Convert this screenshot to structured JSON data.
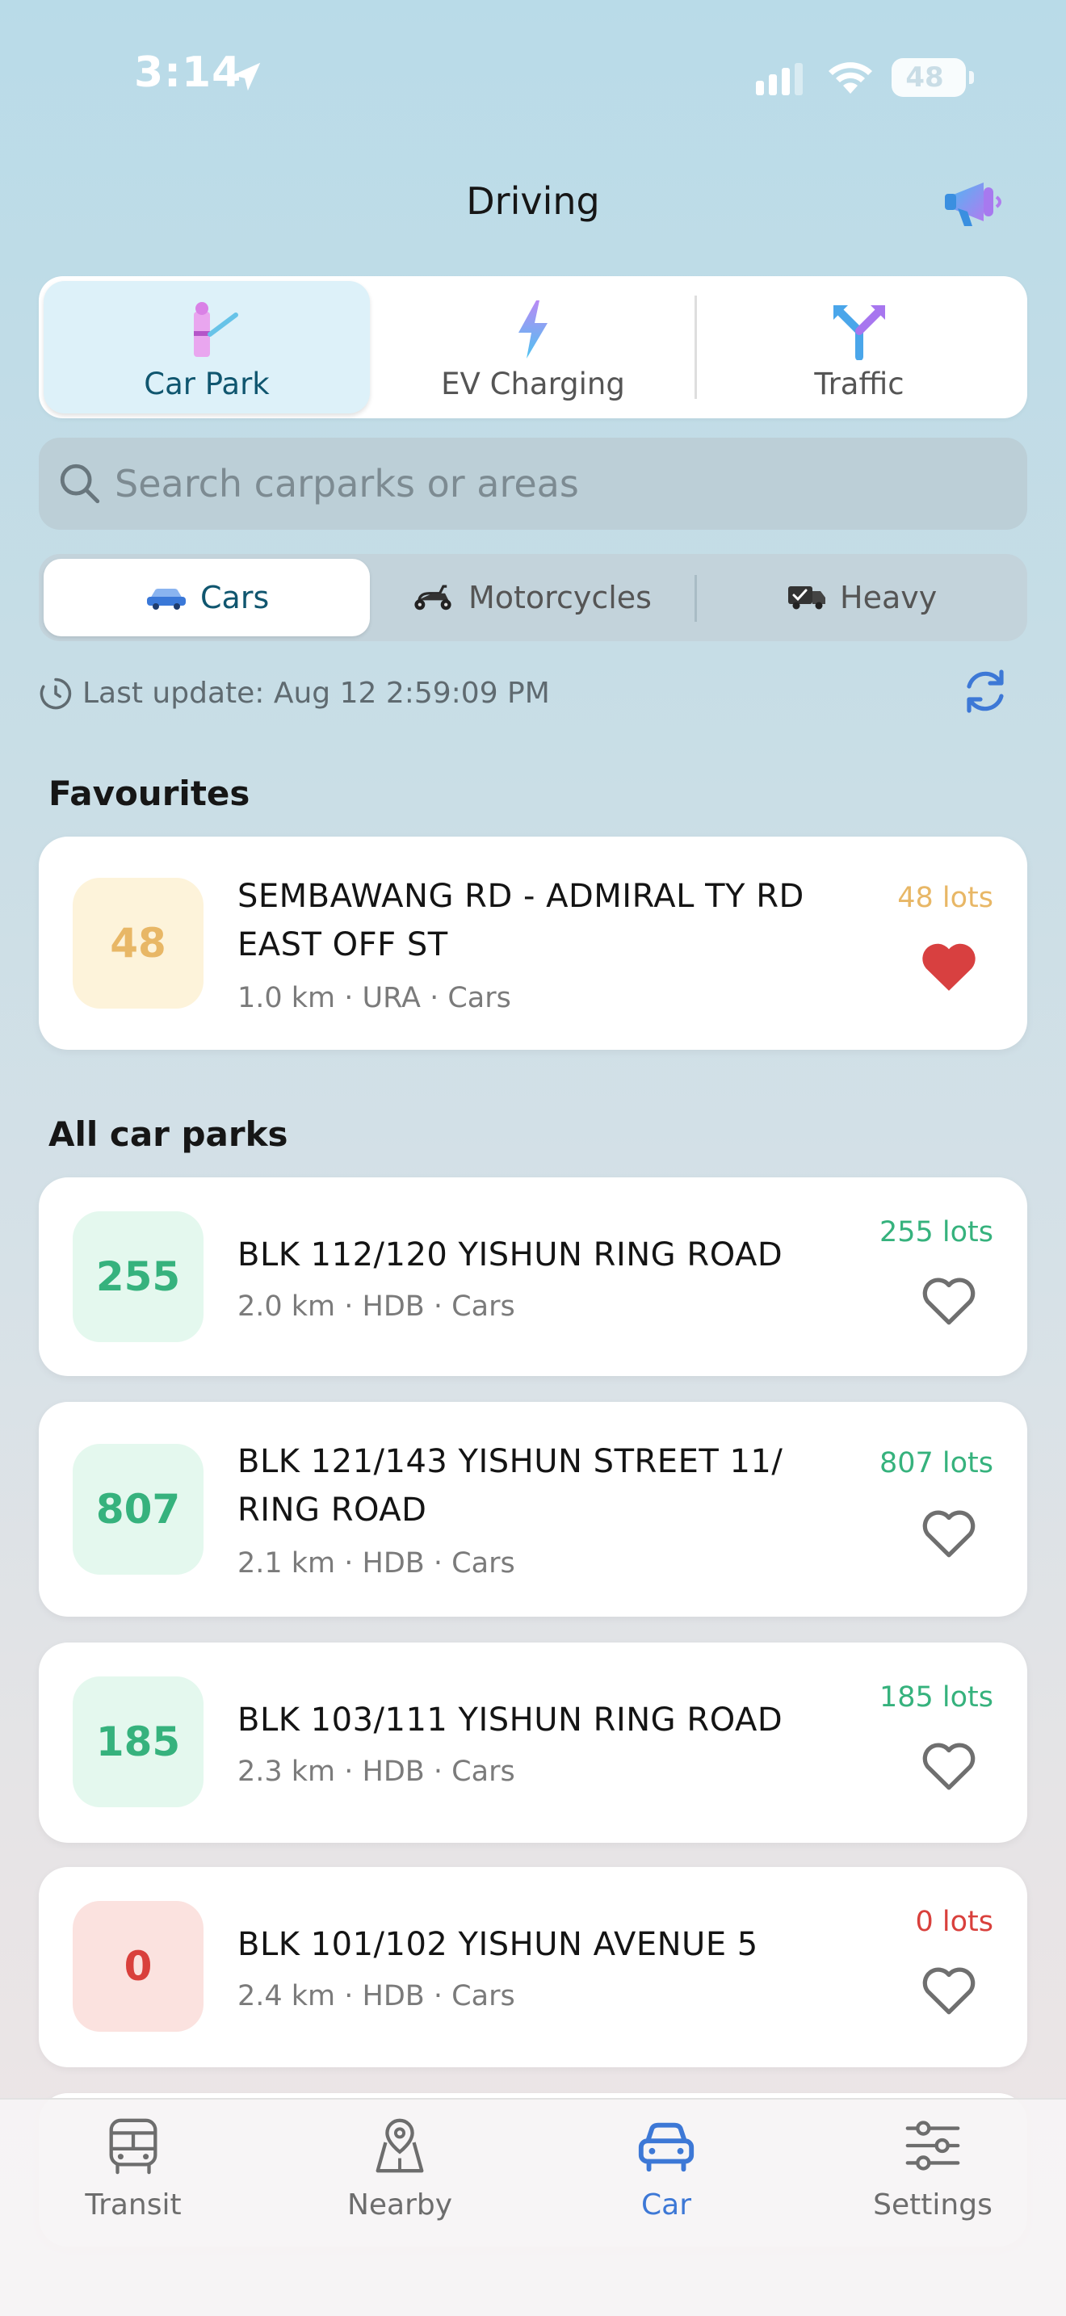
{
  "status_bar": {
    "time": "3:14",
    "battery": "48"
  },
  "header": {
    "title": "Driving"
  },
  "mode_tabs": [
    {
      "label": "Car Park",
      "active": true
    },
    {
      "label": "EV Charging",
      "active": false
    },
    {
      "label": "Traffic",
      "active": false
    }
  ],
  "search": {
    "placeholder": "Search carparks or areas",
    "value": ""
  },
  "vehicle_tabs": [
    {
      "label": "Cars",
      "active": true
    },
    {
      "label": "Motorcycles",
      "active": false
    },
    {
      "label": "Heavy",
      "active": false
    }
  ],
  "last_update": "Last update: Aug 12 2:59:09 PM",
  "favourites": {
    "title": "Favourites",
    "items": [
      {
        "count": "48",
        "name": "SEMBAWANG RD - ADMIRAL TY RD EAST OFF ST",
        "meta": "1.0 km · URA · Cars",
        "lots": "48 lots",
        "status": "yellow",
        "favourite": true
      }
    ]
  },
  "all_car_parks": {
    "title": "All car parks",
    "items": [
      {
        "count": "255",
        "name": "BLK 112/120 YISHUN RING ROAD",
        "meta": "2.0 km · HDB · Cars",
        "lots": "255 lots",
        "status": "green",
        "favourite": false
      },
      {
        "count": "807",
        "name": "BLK 121/143 YISHUN STREET 11/ RING ROAD",
        "meta": "2.1 km · HDB · Cars",
        "lots": "807 lots",
        "status": "green",
        "favourite": false
      },
      {
        "count": "185",
        "name": "BLK 103/111 YISHUN RING ROAD",
        "meta": "2.3 km · HDB · Cars",
        "lots": "185 lots",
        "status": "green",
        "favourite": false
      },
      {
        "count": "0",
        "name": "BLK 101/102 YISHUN AVENUE 5",
        "meta": "2.4 km · HDB · Cars",
        "lots": "0 lots",
        "status": "red",
        "favourite": false
      }
    ]
  },
  "bottom_tabs": [
    {
      "label": "Transit",
      "icon": "bus-icon",
      "active": false
    },
    {
      "label": "Nearby",
      "icon": "map-pin-icon",
      "active": false
    },
    {
      "label": "Car",
      "icon": "car-icon",
      "active": true
    },
    {
      "label": "Settings",
      "icon": "sliders-icon",
      "active": false
    }
  ],
  "colors": {
    "accent": "#3d78d6",
    "green": "#36b27d",
    "yellow": "#e8b766",
    "red": "#d9403c",
    "active_teal": "#10566f"
  }
}
